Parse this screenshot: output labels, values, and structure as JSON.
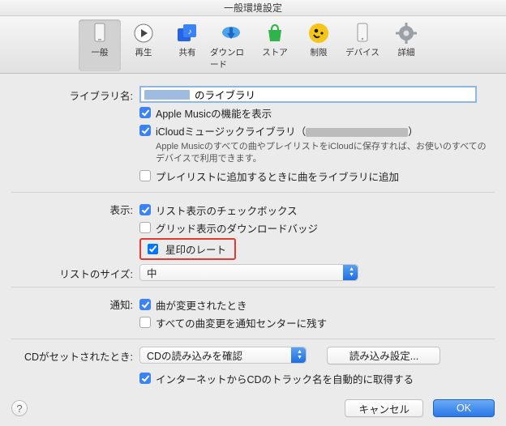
{
  "window": {
    "title": "一般環境設定"
  },
  "toolbar": {
    "items": [
      {
        "id": "general",
        "label": "一般",
        "selected": true
      },
      {
        "id": "playback",
        "label": "再生",
        "selected": false
      },
      {
        "id": "sharing",
        "label": "共有",
        "selected": false
      },
      {
        "id": "downloads",
        "label": "ダウンロード",
        "selected": false
      },
      {
        "id": "store",
        "label": "ストア",
        "selected": false
      },
      {
        "id": "restrict",
        "label": "制限",
        "selected": false
      },
      {
        "id": "devices",
        "label": "デバイス",
        "selected": false
      },
      {
        "id": "advanced",
        "label": "詳細",
        "selected": false
      }
    ]
  },
  "section_library": {
    "label": "ライブラリ名:",
    "input_value": "のライブラリ",
    "chk_apple_music": {
      "checked": true,
      "label": "Apple Musicの機能を表示"
    },
    "chk_icloud": {
      "checked": true,
      "label_pre": "iCloudミュージックライブラリ（",
      "label_post": "）"
    },
    "icloud_help": "Apple Musicのすべての曲やプレイリストをiCloudに保存すれば、お使いのすべてのデバイスで利用できます。",
    "chk_add_playlist": {
      "checked": false,
      "label": "プレイリストに追加するときに曲をライブラリに追加"
    }
  },
  "section_view": {
    "label": "表示:",
    "chk_list": {
      "checked": true,
      "label": "リスト表示のチェックボックス"
    },
    "chk_grid": {
      "checked": false,
      "label": "グリッド表示のダウンロードバッジ"
    },
    "chk_star": {
      "checked": true,
      "label": "星印のレート"
    }
  },
  "section_listsize": {
    "label": "リストのサイズ:",
    "value": "中"
  },
  "section_notify": {
    "label": "通知:",
    "chk_changed": {
      "checked": true,
      "label": "曲が変更されたとき"
    },
    "chk_center": {
      "checked": false,
      "label": "すべての曲変更を通知センターに残す"
    }
  },
  "section_cd": {
    "label": "CDがセットされたとき:",
    "select_value": "CDの読み込みを確認",
    "button_import": "読み込み設定...",
    "chk_internet": {
      "checked": true,
      "label": "インターネットからCDのトラック名を自動的に取得する"
    }
  },
  "footer": {
    "help": "?",
    "cancel": "キャンセル",
    "ok": "OK"
  }
}
